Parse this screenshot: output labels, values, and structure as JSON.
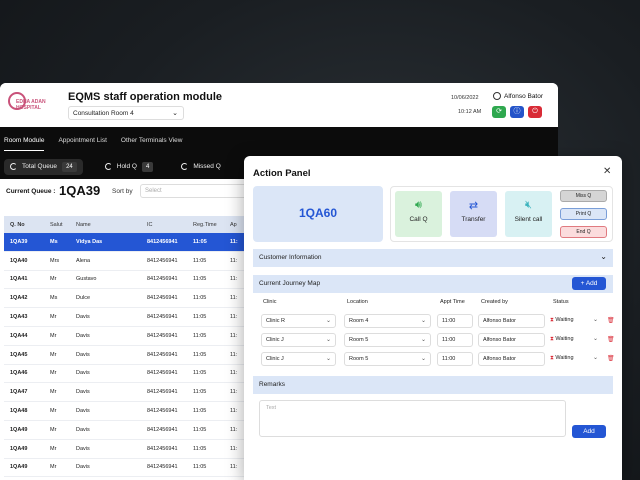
{
  "app": {
    "logo_text": "EDNA ADAN HOSPITAL",
    "title": "EQMS staff operation module",
    "room": "Consultation Room 4",
    "date": "10/06/2022",
    "time": "10:12 AM",
    "user": "Alfonso Bator",
    "colors": {
      "accent": "#2456d4",
      "green": "#2fa84f",
      "red": "#d92b36",
      "nav_bg": "#0c0c0c"
    }
  },
  "nav": {
    "tabs": [
      "Room Module",
      "Appointment List",
      "Other Terminals View"
    ]
  },
  "stats": [
    {
      "label": "Total Queue",
      "count": "24"
    },
    {
      "label": "Hold Q",
      "count": "4"
    },
    {
      "label": "Missed Q",
      "count": ""
    }
  ],
  "queue": {
    "label": "Current Queue :",
    "value": "1QA39",
    "sort_label": "Sort by",
    "sort_placeholder": "Select"
  },
  "table": {
    "headers": [
      "Q. No",
      "Salut",
      "Name",
      "IC",
      "Reg.Time",
      "Ap"
    ],
    "rows": [
      {
        "qno": "1QA39",
        "salut": "Ms",
        "name": "Vidya Das",
        "ic": "8412456941",
        "reg": "11:05",
        "ap": "11:"
      },
      {
        "qno": "1QA40",
        "salut": "Mrs",
        "name": "Alena",
        "ic": "8412456941",
        "reg": "11:05",
        "ap": "11:"
      },
      {
        "qno": "1QA41",
        "salut": "Mr",
        "name": "Gustavo",
        "ic": "8412456941",
        "reg": "11:05",
        "ap": "11:"
      },
      {
        "qno": "1QA42",
        "salut": "Ms",
        "name": "Dulce",
        "ic": "8412456941",
        "reg": "11:05",
        "ap": "11:"
      },
      {
        "qno": "1QA43",
        "salut": "Mr",
        "name": "Davis",
        "ic": "8412456941",
        "reg": "11:05",
        "ap": "11:"
      },
      {
        "qno": "1QA44",
        "salut": "Mr",
        "name": "Davis",
        "ic": "8412456941",
        "reg": "11:05",
        "ap": "11:"
      },
      {
        "qno": "1QA45",
        "salut": "Mr",
        "name": "Davis",
        "ic": "8412456941",
        "reg": "11:05",
        "ap": "11:"
      },
      {
        "qno": "1QA46",
        "salut": "Mr",
        "name": "Davis",
        "ic": "8412456941",
        "reg": "11:05",
        "ap": "11:"
      },
      {
        "qno": "1QA47",
        "salut": "Mr",
        "name": "Davis",
        "ic": "8412456941",
        "reg": "11:05",
        "ap": "11:"
      },
      {
        "qno": "1QA48",
        "salut": "Mr",
        "name": "Davis",
        "ic": "8412456941",
        "reg": "11:05",
        "ap": "11:"
      },
      {
        "qno": "1QA49",
        "salut": "Mr",
        "name": "Davis",
        "ic": "8412456941",
        "reg": "11:05",
        "ap": "11:"
      },
      {
        "qno": "1QA49",
        "salut": "Mr",
        "name": "Davis",
        "ic": "8412456941",
        "reg": "11:05",
        "ap": "11:"
      },
      {
        "qno": "1QA49",
        "salut": "Mr",
        "name": "Davis",
        "ic": "8412456941",
        "reg": "11:05",
        "ap": "11:"
      }
    ]
  },
  "panel": {
    "title": "Action Panel",
    "current_q": "1QA60",
    "actions": {
      "call_q": "Call Q",
      "transfer": "Transfer",
      "silent": "Silent call"
    },
    "small_actions": {
      "miss": "Miss Q",
      "print": "Print Q",
      "end": "End Q"
    },
    "customer_info": "Customer Information",
    "journey_title": "Current Journey Map",
    "add_label": "+ Add",
    "journey_headers": {
      "clinic": "Clinic",
      "location": "Location",
      "appt": "Appt Time",
      "created": "Created by",
      "status": "Status"
    },
    "journey_rows": [
      {
        "clinic": "Clinic R",
        "location": "Room 4",
        "appt": "11:00",
        "created": "Alfonso Bator",
        "status": "Waiting"
      },
      {
        "clinic": "Clinic J",
        "location": "Room 5",
        "appt": "11:00",
        "created": "Alfonso Bator",
        "status": "Waiting"
      },
      {
        "clinic": "Clinic J",
        "location": "Room 5",
        "appt": "11:00",
        "created": "Alfonso Bator",
        "status": "Waiting"
      }
    ],
    "remarks_title": "Remarks",
    "remarks_placeholder": "Text",
    "add_button": "Add"
  }
}
